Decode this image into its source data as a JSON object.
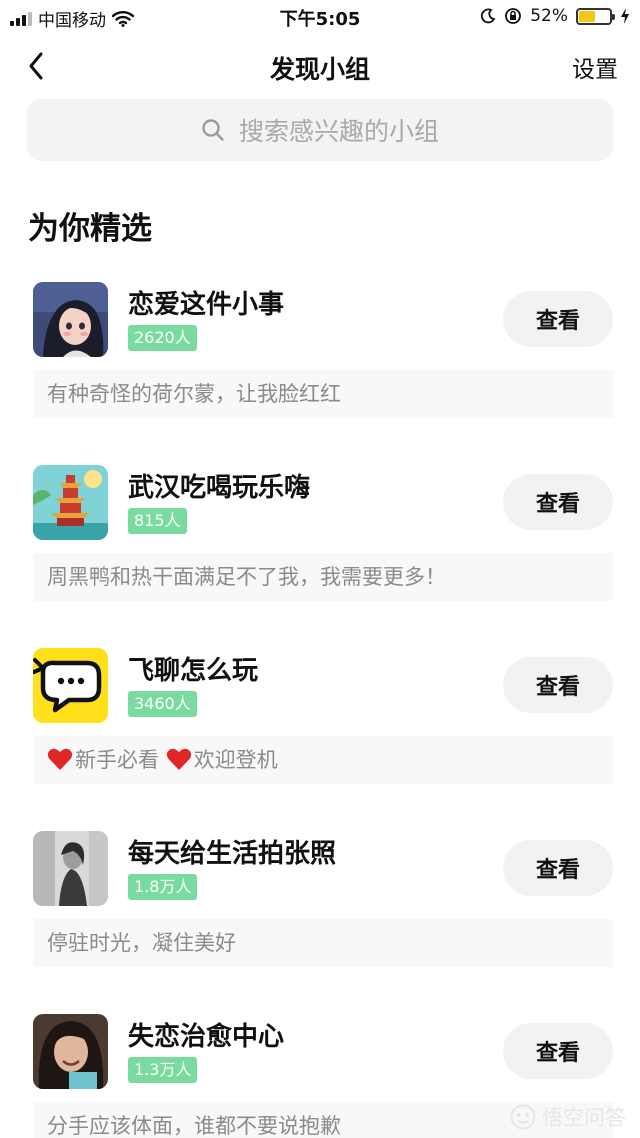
{
  "status_bar": {
    "carrier": "中国移动",
    "time": "下午5:05",
    "battery": "52%",
    "battery_level": 0.52
  },
  "nav": {
    "title": "发现小组",
    "settings_label": "设置"
  },
  "search": {
    "placeholder": "搜索感兴趣的小组"
  },
  "section": {
    "title": "为你精选"
  },
  "groups": [
    {
      "name": "恋爱这件小事",
      "count": "2620人",
      "button": "查看",
      "desc": "有种奇怪的荷尔蒙，让我脸红红"
    },
    {
      "name": "武汉吃喝玩乐嗨",
      "count": "815人",
      "button": "查看",
      "desc": "周黑鸭和热干面满足不了我，我需要更多！"
    },
    {
      "name": "飞聊怎么玩",
      "count": "3460人",
      "button": "查看",
      "desc_parts": [
        "新手必看",
        "欢迎登机"
      ]
    },
    {
      "name": "每天给生活拍张照",
      "count": "1.8万人",
      "button": "查看",
      "desc": "停驻时光，凝住美好"
    },
    {
      "name": "失恋治愈中心",
      "count": "1.3万人",
      "button": "查看",
      "desc": "分手应该体面，谁都不要说抱歉"
    }
  ],
  "watermark": "悟空问答",
  "colors": {
    "badge": "#7adba0",
    "button_bg": "#f2f2f3",
    "desc_bg": "#f8f8f9",
    "feiliao_yellow": "#ffe01a"
  }
}
